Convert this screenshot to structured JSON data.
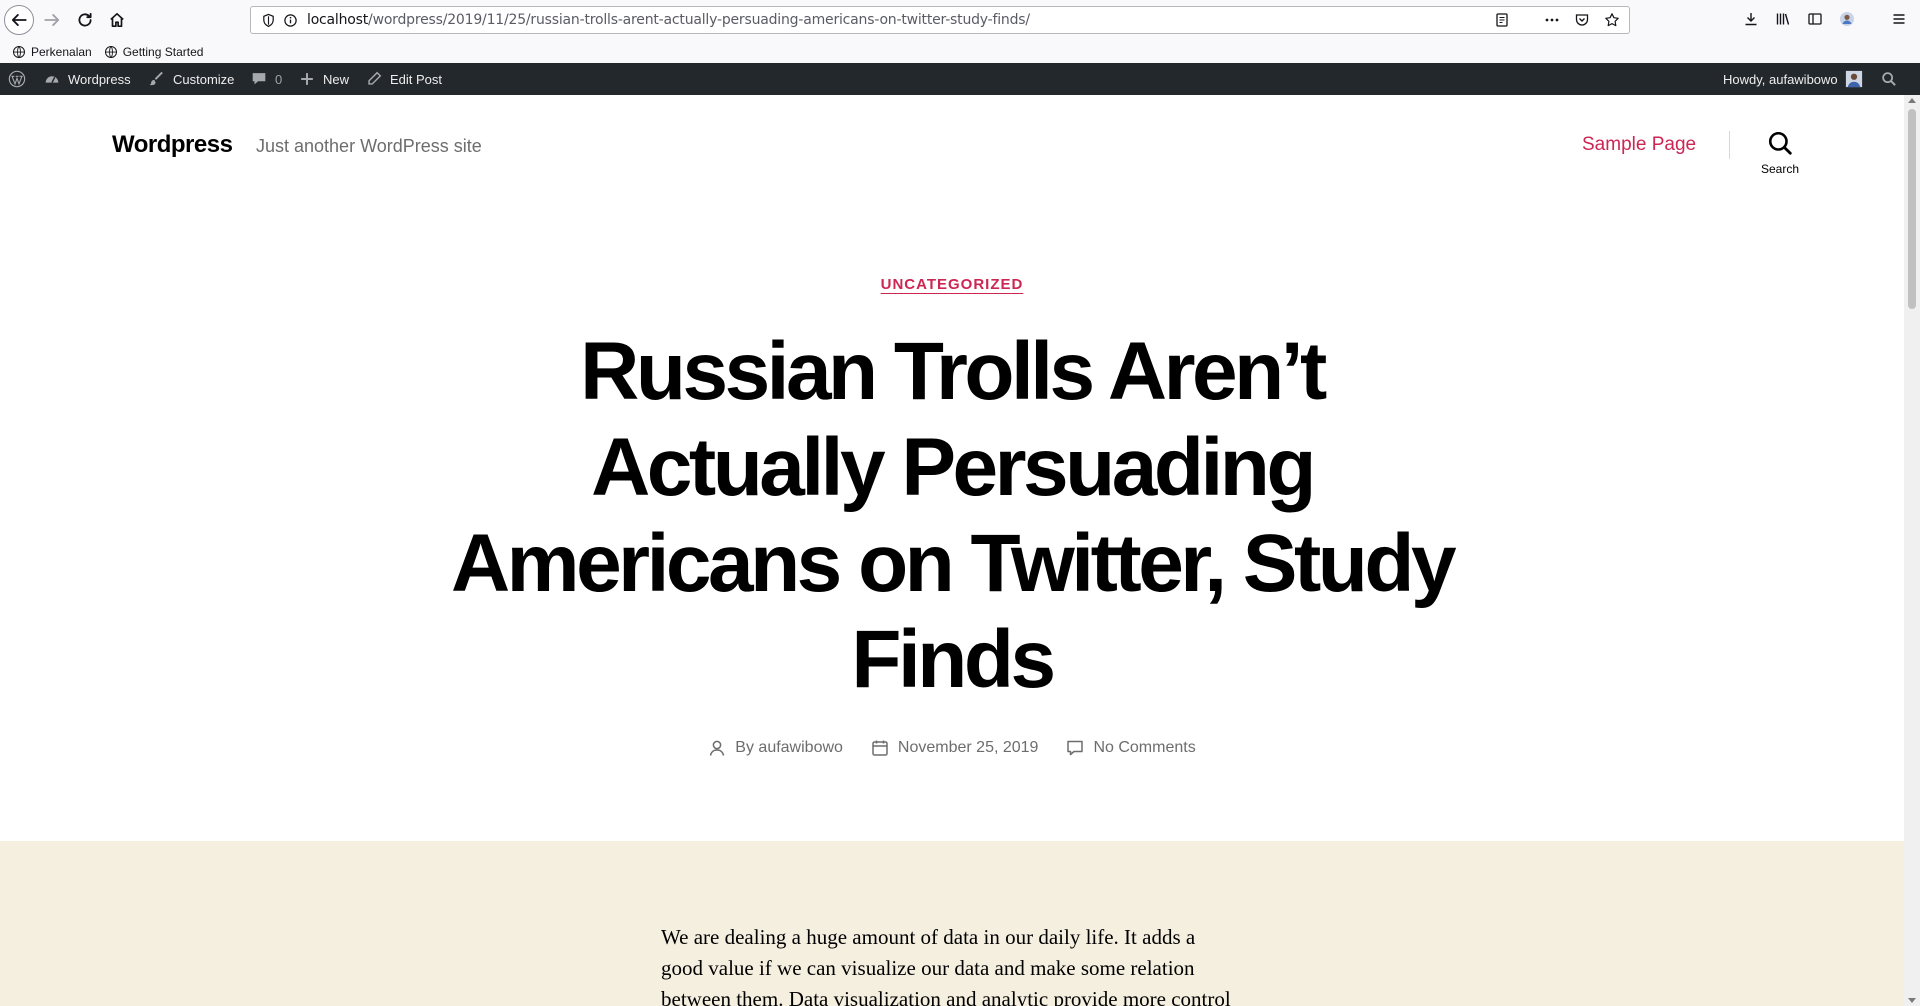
{
  "browser": {
    "url_host": "localhost",
    "url_path": "/wordpress/2019/11/25/russian-trolls-arent-actually-persuading-americans-on-twitter-study-finds/",
    "bookmarks": [
      "Perkenalan",
      "Getting Started"
    ]
  },
  "adminbar": {
    "site_name": "Wordpress",
    "customize": "Customize",
    "comments_count": "0",
    "new_label": "New",
    "edit_post": "Edit Post",
    "howdy": "Howdy, aufawibowo"
  },
  "site": {
    "title": "Wordpress",
    "description": "Just another WordPress site",
    "menu_item": "Sample Page",
    "search_label": "Search"
  },
  "post": {
    "category": "UNCATEGORIZED",
    "title": "Russian Trolls Aren’t Actually Persuading Americans on Twitter, Study Finds",
    "author": "By aufawibowo",
    "date": "November 25, 2019",
    "comments": "No Comments",
    "content": "We are dealing a huge amount of data in our daily life. It adds a good value if we can visualize our data and make some relation between them. Data visualization and analytic provide more control over data"
  },
  "colors": {
    "accent": "#cd2653",
    "adminbar_bg": "#23282d",
    "content_bg": "#f5efe0"
  }
}
